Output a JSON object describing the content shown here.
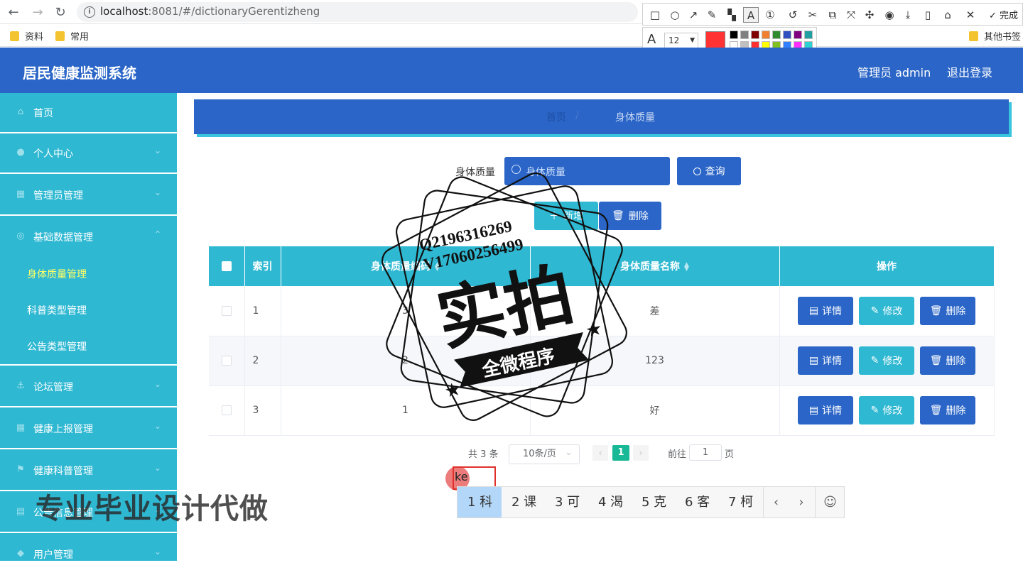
{
  "browser": {
    "url_host": "localhost",
    "url_rest": ":8081/#/dictionaryGerentizheng",
    "bookmarks": [
      "资料",
      "常用"
    ],
    "other_bookmarks": "其他书签"
  },
  "screenshot_tool": {
    "done_label": "完成",
    "font_size": "12",
    "current_color": "#ff3333",
    "palette": [
      "#000000",
      "#808080",
      "#800000",
      "#f08030",
      "#2e8b2e",
      "#3050c0",
      "#800080",
      "#20a0a0",
      "#ffffff",
      "#c0c0c0",
      "#ff3030",
      "#ffff00",
      "#80c020",
      "#3080ff",
      "#ff30ff",
      "#30d0d0"
    ]
  },
  "header": {
    "title": "居民健康监测系统",
    "admin": "管理员 admin",
    "logout": "退出登录"
  },
  "sidebar": {
    "items": [
      {
        "label": "首页"
      },
      {
        "label": "个人中心"
      },
      {
        "label": "管理员管理"
      },
      {
        "label": "基础数据管理"
      },
      {
        "label": "论坛管理"
      },
      {
        "label": "健康上报管理"
      },
      {
        "label": "健康科普管理"
      },
      {
        "label": "公告信息管理"
      },
      {
        "label": "用户管理"
      }
    ],
    "sub_items": [
      {
        "label": "身体质量管理",
        "active": true
      },
      {
        "label": "科普类型管理",
        "active": false
      },
      {
        "label": "公告类型管理",
        "active": false
      }
    ]
  },
  "breadcrumb": {
    "home": "首页",
    "separator": "/",
    "current": "身体质量"
  },
  "search": {
    "label": "身体质量",
    "placeholder": "身体质量",
    "button": "查询"
  },
  "actions": {
    "add": "新增",
    "delete": "删除"
  },
  "table": {
    "headers": {
      "index": "索引",
      "code": "身体质量编码",
      "name": "身体质量名称",
      "ops": "操作"
    },
    "rows": [
      {
        "index": "1",
        "code": "3",
        "name": "差"
      },
      {
        "index": "2",
        "code": "2",
        "name": "123"
      },
      {
        "index": "3",
        "code": "1",
        "name": "好"
      }
    ],
    "op_labels": {
      "detail": "详情",
      "edit": "修改",
      "delete": "删除"
    }
  },
  "pagination": {
    "total": "共 3 条",
    "page_size": "10条/页",
    "current_page": "1",
    "goto_label": "前往",
    "goto_value": "1",
    "page_unit": "页"
  },
  "ime": {
    "typed": "ke",
    "candidates": [
      "1 科",
      "2 课",
      "3 可",
      "4 渴",
      "5 克",
      "6 客",
      "7 柯"
    ]
  },
  "watermark": {
    "qq": "Q2196316269",
    "wx": "V17060256499",
    "big": "实拍",
    "ribbon": "全微程序",
    "bottom": "专业毕业设计代做"
  },
  "colors": {
    "primary_blue": "#2a65c7",
    "cyan": "#2fb8d2",
    "active_yellow": "#ffff66",
    "pager_green": "#19b896"
  }
}
